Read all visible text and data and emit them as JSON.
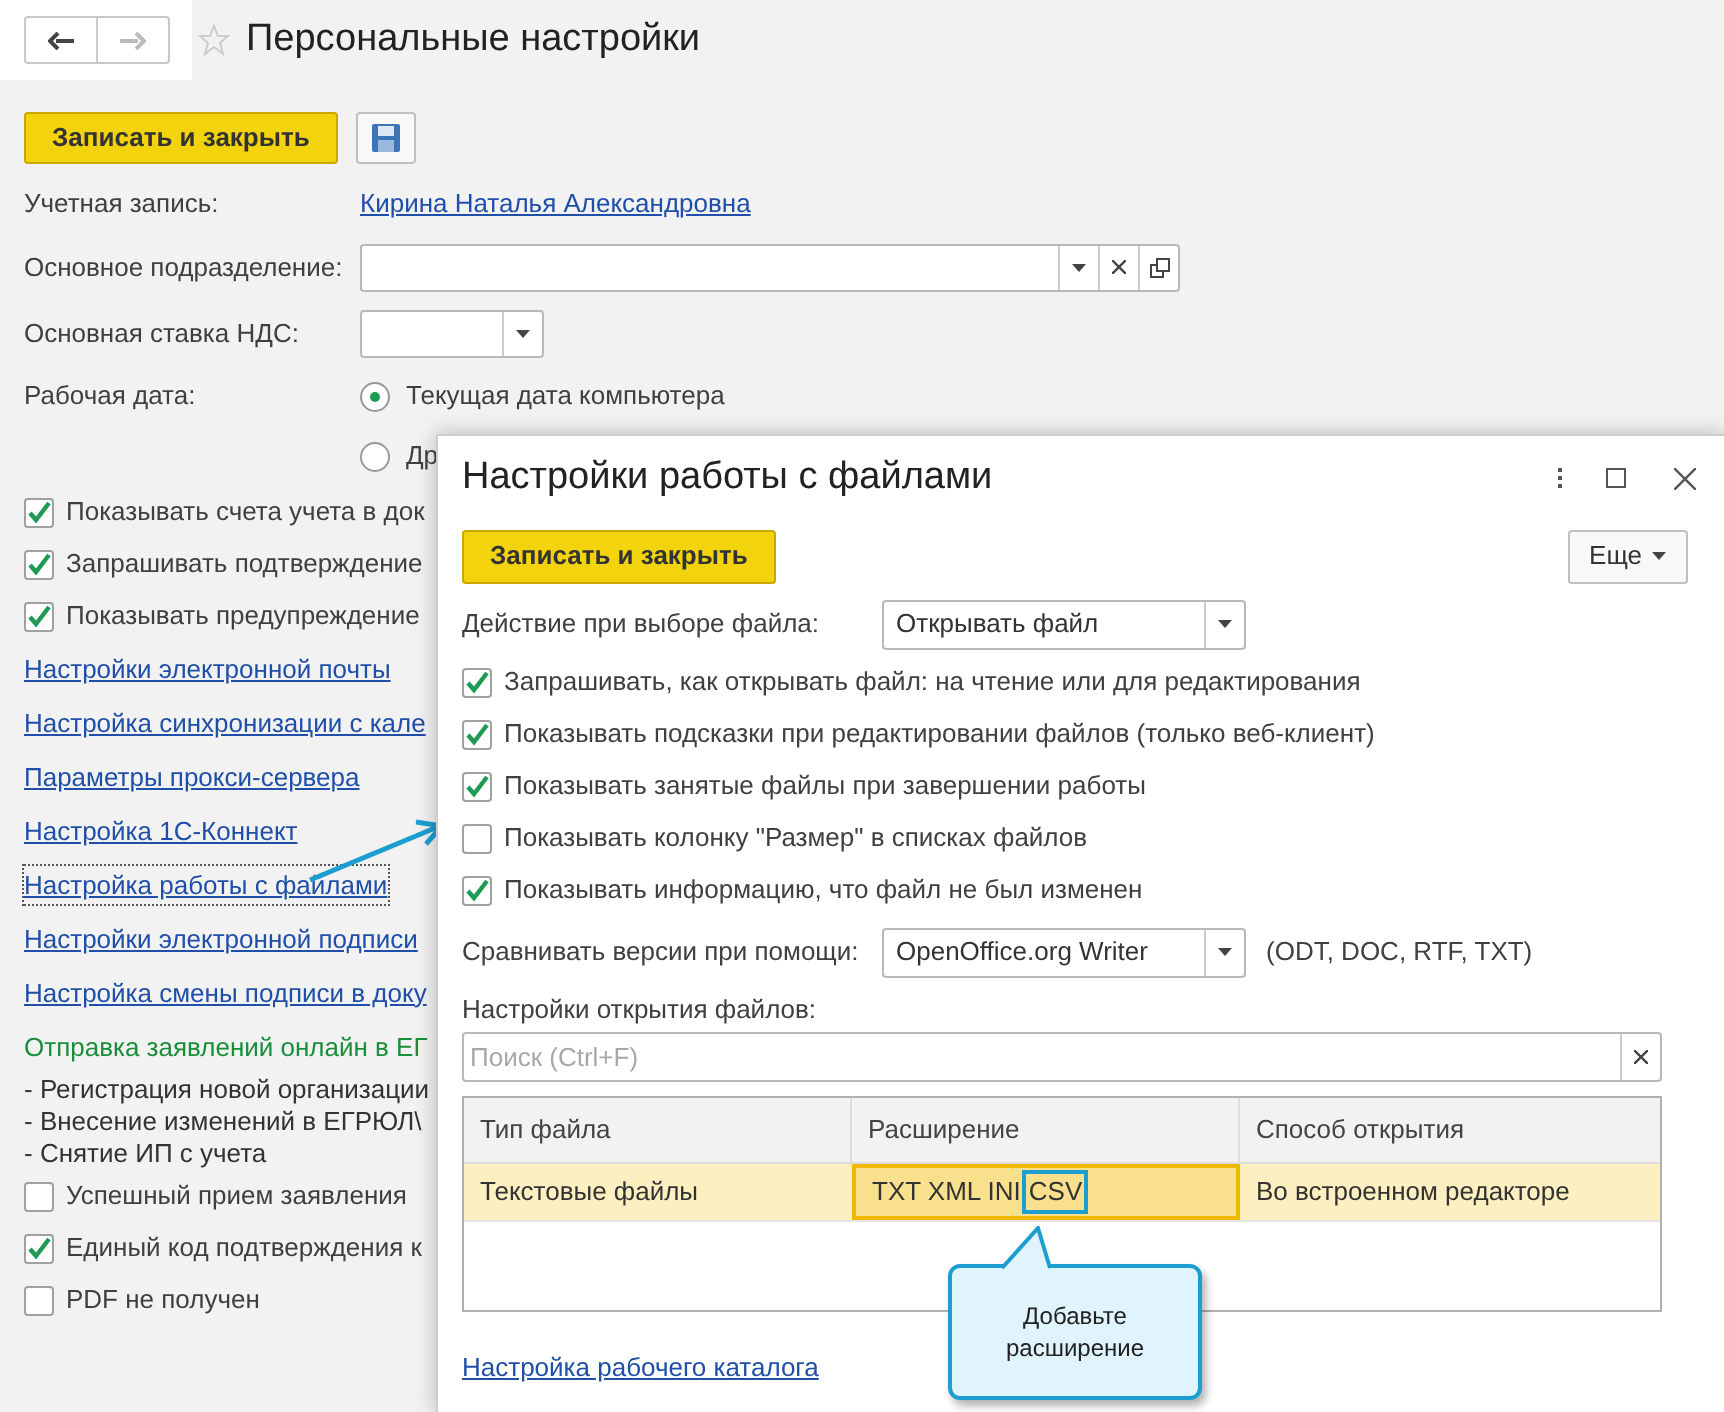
{
  "page": {
    "title": "Персональные настройки",
    "save_close": "Записать и закрыть",
    "fields": [
      {
        "kind": "link",
        "label": "Учетная запись:",
        "value": "Кирина Наталья Александровна"
      },
      {
        "kind": "combo",
        "label": "Основное подразделение:"
      },
      {
        "kind": "select",
        "label": "Основная ставка НДС:"
      },
      {
        "kind": "radio",
        "label": "Рабочая дата:",
        "options": [
          {
            "label": "Текущая дата компьютера",
            "selected": true
          },
          {
            "label": "Др",
            "selected": false
          }
        ]
      }
    ],
    "items": [
      {
        "kind": "check",
        "label": "Показывать счета учета в док",
        "checked": true
      },
      {
        "kind": "check",
        "label": "Запрашивать подтверждение",
        "checked": true
      },
      {
        "kind": "check",
        "label": "Показывать предупреждение",
        "checked": true
      },
      {
        "kind": "link",
        "label": "Настройки электронной почты"
      },
      {
        "kind": "link",
        "label": "Настройка синхронизации с кале"
      },
      {
        "kind": "link",
        "label": "Параметры прокси-сервера"
      },
      {
        "kind": "link",
        "label": "Настройка 1С-Коннект"
      },
      {
        "kind": "link",
        "label": "Настройка работы с файлами",
        "selected": true
      },
      {
        "kind": "link",
        "label": "Настройки электронной подписи"
      },
      {
        "kind": "link",
        "label": "Настройка смены подписи в доку"
      },
      {
        "kind": "heading",
        "label": "Отправка заявлений онлайн в ЕГ"
      },
      {
        "kind": "note",
        "label": "- Регистрация новой организации"
      },
      {
        "kind": "note",
        "label": "- Внесение изменений в ЕГРЮЛ\\"
      },
      {
        "kind": "note",
        "label": "- Снятие ИП с учета"
      },
      {
        "kind": "check",
        "label": "Успешный прием заявления",
        "checked": false
      },
      {
        "kind": "check",
        "label": "Единый код подтверждения к",
        "checked": true
      },
      {
        "kind": "check",
        "label": "PDF не получен",
        "checked": false
      }
    ]
  },
  "dialog": {
    "title": "Настройки работы с файлами",
    "save_close": "Записать и закрыть",
    "more": "Еще",
    "action": {
      "label": "Действие при выборе файла:",
      "value": "Открывать файл"
    },
    "checks": [
      {
        "label": "Запрашивать, как открывать файл: на чтение или для редактирования",
        "checked": true
      },
      {
        "label": "Показывать подсказки при редактировании файлов (только веб-клиент)",
        "checked": true
      },
      {
        "label": "Показывать занятые файлы при завершении работы",
        "checked": true
      },
      {
        "label": "Показывать колонку \"Размер\" в списках файлов",
        "checked": false
      },
      {
        "label": "Показывать информацию, что файл не был изменен",
        "checked": true
      }
    ],
    "compare": {
      "label": "Сравнивать версии при помощи:",
      "value": "OpenOffice.org Writer",
      "note": "(ODT, DOC, RTF, TXT)"
    },
    "table_label": "Настройки открытия файлов:",
    "search": {
      "placeholder": "Поиск (Ctrl+F)"
    },
    "table": {
      "columns": [
        "Тип файла",
        "Расширение",
        "Способ открытия"
      ],
      "rows": [
        {
          "type": "Текстовые файлы",
          "ext": "TXT XML INI",
          "ext_new": "CSV",
          "mode": "Во встроенном редакторе",
          "selected": true
        }
      ]
    },
    "link": "Настройка рабочего каталога",
    "callout": "Добавьте расширение"
  }
}
